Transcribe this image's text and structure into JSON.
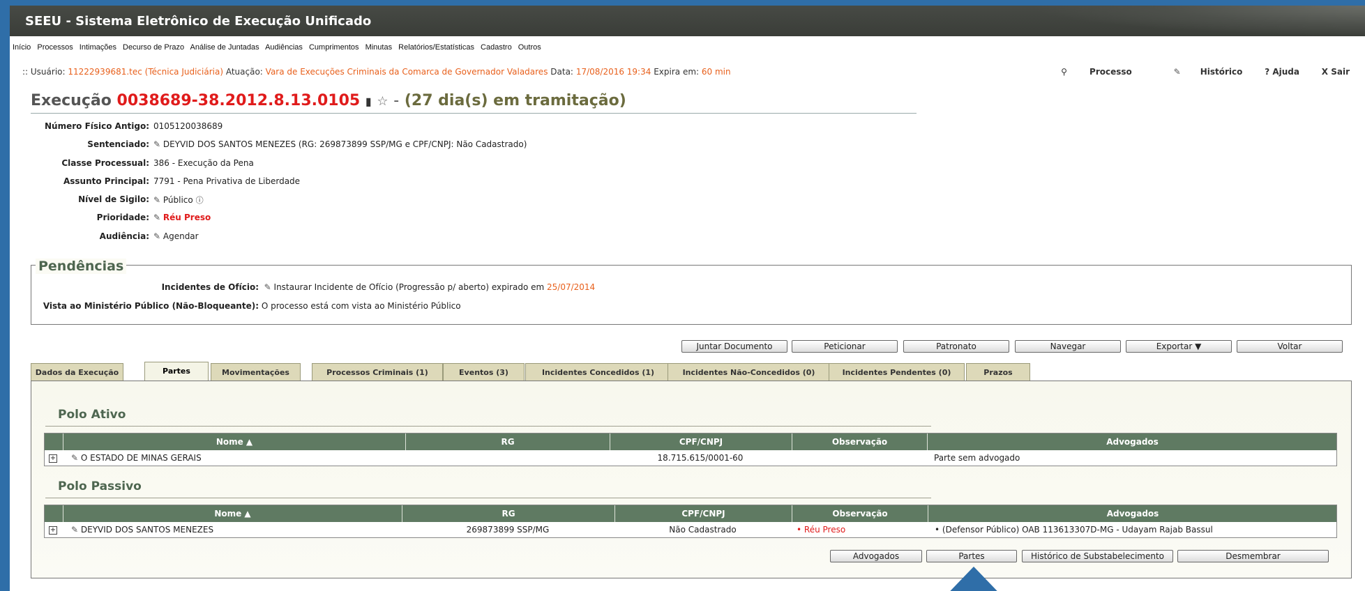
{
  "app": {
    "title": "SEEU - Sistema Eletrônico de Execução Unificado"
  },
  "menu": [
    "Início",
    "Processos",
    "Intimações",
    "Decurso de Prazo",
    "Análise de Juntadas",
    "Audiências",
    "Cumprimentos",
    "Minutas",
    "Relatórios/Estatísticas",
    "Cadastro",
    "Outros"
  ],
  "userbar": {
    "prefix": ":: Usuário:",
    "user": "11222939681.tec (Técnica Judiciária)",
    "atuacao_lbl": "Atuação:",
    "atuacao": "Vara de Execuções Criminais da Comarca de Governador Valadares",
    "data_lbl": "Data:",
    "data": "17/08/2016 19:34",
    "expira_lbl": "Expira em:",
    "expira": "60 min"
  },
  "rightnav": {
    "processo": "Processo",
    "historico": "Histórico",
    "ajuda": "? Ajuda",
    "sair": "X Sair"
  },
  "execucao": {
    "label": "Execução",
    "numero": "0038689-38.2012.8.13.0105",
    "sep": "-",
    "tramitacao": "(27 dia(s) em tramitação)"
  },
  "fields": [
    {
      "label": "Número Físico Antigo:",
      "value": "0105120038689"
    },
    {
      "label": "Sentenciado:",
      "value": "DEYVID DOS SANTOS MENEZES (RG: 269873899 SSP/MG e CPF/CNPJ: Não Cadastrado)"
    },
    {
      "label": "Classe Processual:",
      "value": "386 - Execução da Pena"
    },
    {
      "label": "Assunto Principal:",
      "value": "7791 - Pena Privativa de Liberdade"
    },
    {
      "label": "Nível de Sigilo:",
      "value": "Público"
    },
    {
      "label": "Prioridade:",
      "value": "Réu Preso"
    },
    {
      "label": "Audiência:",
      "value": "Agendar"
    }
  ],
  "pendencias": {
    "title": "Pendências",
    "incidentes_lbl": "Incidentes de Ofício:",
    "incidentes_text": "Instaurar Incidente de Ofício (Progressão p/ aberto) expirado em",
    "incidentes_date": "25/07/2014",
    "vista_lbl": "Vista ao Ministério Público (Não-Bloqueante):",
    "vista_text": "O processo está com vista ao Ministério Público"
  },
  "actions": [
    "Juntar Documento",
    "Peticionar",
    "Patronato",
    "Navegar",
    "Exportar ▼",
    "Voltar"
  ],
  "tabs": [
    "Dados da Execução",
    "Partes",
    "Movimentações",
    "Processos Criminais (1)",
    "Eventos (3)",
    "Incidentes Concedidos (1)",
    "Incidentes Não-Concedidos (0)",
    "Incidentes Pendentes (0)",
    "Prazos"
  ],
  "columns": [
    "Nome ▲",
    "RG",
    "CPF/CNPJ",
    "Observação",
    "Advogados"
  ],
  "polo_ativo": {
    "title": "Polo Ativo",
    "row": {
      "nome": "O ESTADO DE MINAS GERAIS",
      "rg": "",
      "cpf": "18.715.615/0001-60",
      "obs": "",
      "adv": "Parte sem advogado"
    }
  },
  "polo_passivo": {
    "title": "Polo Passivo",
    "row": {
      "nome": "DEYVID DOS SANTOS MENEZES",
      "rg": "269873899 SSP/MG",
      "cpf": "Não Cadastrado",
      "obs": "• Réu Preso",
      "adv": "• (Defensor Público) OAB 113613307D-MG - Udayam Rajab Bassul"
    }
  },
  "bottom_buttons": [
    "Advogados",
    "Partes",
    "Histórico de Substabelecimento",
    "Desmembrar"
  ],
  "colors": {
    "accent": "#e01b1b",
    "orange": "#e8601c",
    "header": "#5f7a62",
    "arrow": "#2f6ea8"
  }
}
